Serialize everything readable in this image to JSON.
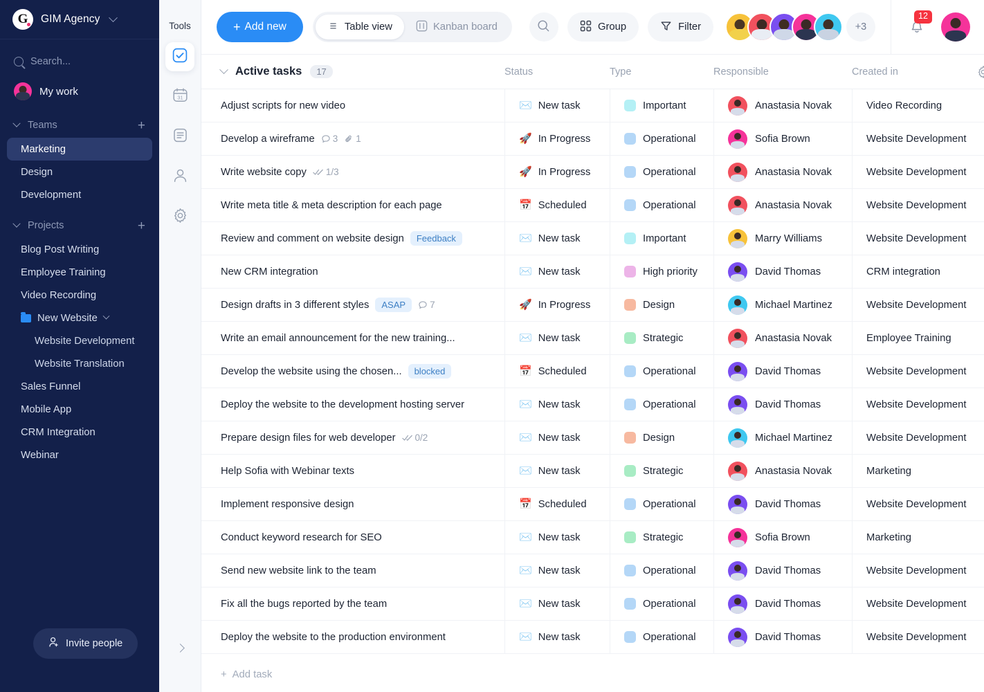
{
  "sidebar": {
    "brand": {
      "logo_letter": "G",
      "name": "GIM Agency",
      "chevron_icon": "chevron-down-icon"
    },
    "search": {
      "placeholder": "Search...",
      "value": "",
      "icon": "search-icon"
    },
    "my_work": {
      "label": "My work",
      "avatar_color": "#f5339a"
    },
    "teams": {
      "label": "Teams",
      "add_label": "+",
      "items": [
        {
          "label": "Marketing",
          "active": true
        },
        {
          "label": "Design",
          "active": false
        },
        {
          "label": "Development",
          "active": false
        }
      ]
    },
    "projects": {
      "label": "Projects",
      "add_label": "+",
      "items": [
        {
          "label": "Blog Post Writing",
          "type": "item"
        },
        {
          "label": "Employee Training",
          "type": "item"
        },
        {
          "label": "Video Recording",
          "type": "item"
        },
        {
          "label": "New Website",
          "type": "folder"
        },
        {
          "label": "Website Development",
          "type": "sub"
        },
        {
          "label": "Website Translation",
          "type": "sub"
        },
        {
          "label": "Sales Funnel",
          "type": "item"
        },
        {
          "label": "Mobile App",
          "type": "item"
        },
        {
          "label": "CRM Integration",
          "type": "item"
        },
        {
          "label": "Webinar",
          "type": "item"
        }
      ]
    },
    "invite_button": {
      "label": "Invite people",
      "icon": "add-person-icon"
    }
  },
  "toolrail": {
    "title": "Tools",
    "items": [
      {
        "icon": "checkbox-check-icon",
        "active": true
      },
      {
        "icon": "calendar-icon",
        "active": false,
        "day": "31"
      },
      {
        "icon": "document-icon",
        "active": false
      },
      {
        "icon": "person-icon",
        "active": false
      },
      {
        "icon": "gear-icon",
        "active": false
      }
    ],
    "expand_icon": "chevron-right-icon"
  },
  "topbar": {
    "add_new": {
      "label": "Add new",
      "plus": "+"
    },
    "views": [
      {
        "label": "Table view",
        "icon": "table-view-icon",
        "active": true
      },
      {
        "label": "Kanban board",
        "icon": "kanban-board-icon",
        "active": false
      }
    ],
    "search_icon": "search-icon",
    "group": {
      "label": "Group",
      "icon": "grid-icon"
    },
    "filter": {
      "label": "Filter",
      "icon": "funnel-icon"
    },
    "members": [
      {
        "color": "#f7c23a"
      },
      {
        "color": "#f1515e"
      },
      {
        "color": "#7a4ef0"
      },
      {
        "color": "#f5339a"
      },
      {
        "color": "#3fc8f0"
      }
    ],
    "members_more": "+3",
    "notifications": {
      "count": "12",
      "icon": "bell-icon"
    },
    "user_avatar_color": "#f5339a"
  },
  "table": {
    "group_title": "Active tasks",
    "group_count": "17",
    "collapse_icon": "chevron-down-icon",
    "settings_icon": "gear-icon",
    "columns": [
      "Status",
      "Type",
      "Responsible",
      "Created in"
    ],
    "add_task_label": "Add task",
    "status_icons": {
      "New task": "✉️",
      "In Progress": "🚀",
      "Scheduled": "📅"
    },
    "type_colors": {
      "Important": "#b4f0f5",
      "Operational": "#b4d7f7",
      "High priority": "#edb4e8",
      "Design": "#f7b9a0",
      "Strategic": "#a8ecc4"
    },
    "people_colors": {
      "Anastasia Novak": "#f1515e",
      "Sofia Brown": "#f5339a",
      "Marry Williams": "#f7c23a",
      "David Thomas": "#7a4ef0",
      "Michael Martinez": "#3fc8f0"
    },
    "rows": [
      {
        "task": "Adjust scripts for new video",
        "tag": null,
        "comments": null,
        "attachments": null,
        "subtasks": null,
        "status": "New task",
        "type": "Important",
        "responsible": "Anastasia Novak",
        "created_in": "Video Recording"
      },
      {
        "task": "Develop a wireframe",
        "tag": null,
        "comments": "3",
        "attachments": "1",
        "subtasks": null,
        "status": "In Progress",
        "type": "Operational",
        "responsible": "Sofia Brown",
        "created_in": "Website Development"
      },
      {
        "task": "Write website copy",
        "tag": null,
        "comments": null,
        "attachments": null,
        "subtasks": "1/3",
        "status": "In Progress",
        "type": "Operational",
        "responsible": "Anastasia Novak",
        "created_in": "Website Development"
      },
      {
        "task": "Write meta title & meta description for each page",
        "tag": null,
        "comments": null,
        "attachments": null,
        "subtasks": null,
        "status": "Scheduled",
        "type": "Operational",
        "responsible": "Anastasia Novak",
        "created_in": "Website Development"
      },
      {
        "task": "Review and comment on website design",
        "tag": "Feedback",
        "comments": null,
        "attachments": null,
        "subtasks": null,
        "status": "New task",
        "type": "Important",
        "responsible": "Marry Williams",
        "created_in": "Website Development"
      },
      {
        "task": "New CRM integration",
        "tag": null,
        "comments": null,
        "attachments": null,
        "subtasks": null,
        "status": "New task",
        "type": "High priority",
        "responsible": "David Thomas",
        "created_in": "CRM integration"
      },
      {
        "task": "Design drafts in 3 different styles",
        "tag": "ASAP",
        "comments": "7",
        "attachments": null,
        "subtasks": null,
        "status": "In Progress",
        "type": "Design",
        "responsible": "Michael Martinez",
        "created_in": "Website Development"
      },
      {
        "task": "Write an email announcement for the new training...",
        "tag": null,
        "comments": null,
        "attachments": null,
        "subtasks": null,
        "status": "New task",
        "type": "Strategic",
        "responsible": "Anastasia Novak",
        "created_in": "Employee Training"
      },
      {
        "task": "Develop the website using the chosen...",
        "tag": "blocked",
        "comments": null,
        "attachments": null,
        "subtasks": null,
        "status": "Scheduled",
        "type": "Operational",
        "responsible": "David Thomas",
        "created_in": "Website Development"
      },
      {
        "task": "Deploy the website to the development hosting server",
        "tag": null,
        "comments": null,
        "attachments": null,
        "subtasks": null,
        "status": "New task",
        "type": "Operational",
        "responsible": "David Thomas",
        "created_in": "Website Development"
      },
      {
        "task": "Prepare design files for web developer",
        "tag": null,
        "comments": null,
        "attachments": null,
        "subtasks": "0/2",
        "status": "New task",
        "type": "Design",
        "responsible": "Michael Martinez",
        "created_in": "Website Development"
      },
      {
        "task": "Help Sofia with Webinar texts",
        "tag": null,
        "comments": null,
        "attachments": null,
        "subtasks": null,
        "status": "New task",
        "type": "Strategic",
        "responsible": "Anastasia Novak",
        "created_in": "Marketing"
      },
      {
        "task": "Implement responsive design",
        "tag": null,
        "comments": null,
        "attachments": null,
        "subtasks": null,
        "status": "Scheduled",
        "type": "Operational",
        "responsible": "David Thomas",
        "created_in": "Website Development"
      },
      {
        "task": "Conduct keyword research for SEO",
        "tag": null,
        "comments": null,
        "attachments": null,
        "subtasks": null,
        "status": "New task",
        "type": "Strategic",
        "responsible": "Sofia Brown",
        "created_in": "Marketing"
      },
      {
        "task": "Send new website link to the team",
        "tag": null,
        "comments": null,
        "attachments": null,
        "subtasks": null,
        "status": "New task",
        "type": "Operational",
        "responsible": "David Thomas",
        "created_in": "Website Development"
      },
      {
        "task": "Fix all the bugs reported by the team",
        "tag": null,
        "comments": null,
        "attachments": null,
        "subtasks": null,
        "status": "New task",
        "type": "Operational",
        "responsible": "David Thomas",
        "created_in": "Website Development"
      },
      {
        "task": "Deploy the website to the production environment",
        "tag": null,
        "comments": null,
        "attachments": null,
        "subtasks": null,
        "status": "New task",
        "type": "Operational",
        "responsible": "David Thomas",
        "created_in": "Website Development"
      }
    ]
  }
}
